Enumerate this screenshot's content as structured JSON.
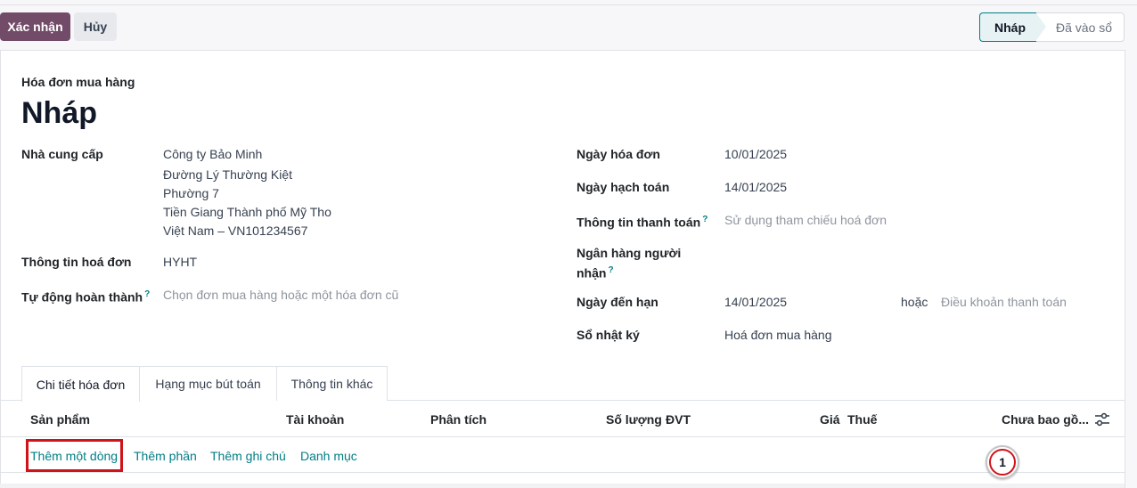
{
  "toolbar": {
    "confirm_label": "Xác nhận",
    "cancel_label": "Hủy"
  },
  "statusbar": {
    "active": "Nháp",
    "next": "Đã vào sổ"
  },
  "header": {
    "doc_type": "Hóa đơn mua hàng",
    "title": "Nháp"
  },
  "left_fields": {
    "vendor_label": "Nhà cung cấp",
    "vendor_lines": [
      "Công ty Bảo Minh",
      "Đường Lý Thường Kiệt",
      "Phường 7",
      "Tiền Giang Thành phố Mỹ Tho",
      "Việt Nam – VN101234567"
    ],
    "bill_ref_label": "Thông tin hoá đơn",
    "bill_ref_value": "HYHT",
    "autocomplete_label": "Tự động hoàn thành",
    "autocomplete_help": "?",
    "autocomplete_placeholder": "Chọn đơn mua hàng hoặc một hóa đơn cũ"
  },
  "right_fields": {
    "invoice_date_label": "Ngày hóa đơn",
    "invoice_date_value": "10/01/2025",
    "accounting_date_label": "Ngày hạch toán",
    "accounting_date_value": "14/01/2025",
    "payment_ref_label": "Thông tin thanh toán",
    "payment_ref_help": "?",
    "payment_ref_placeholder": "Sử dụng tham chiếu hoá đơn",
    "bank_label_line1": "Ngân hàng người",
    "bank_label_line2": "nhận",
    "bank_help": "?",
    "due_date_label": "Ngày đến hạn",
    "due_date_value": "14/01/2025",
    "or_text": "hoặc",
    "payment_terms_placeholder": "Điều khoản thanh toán",
    "journal_label": "Sổ nhật ký",
    "journal_value": "Hoá đơn mua hàng"
  },
  "tabs": [
    {
      "label": "Chi tiết hóa đơn"
    },
    {
      "label": "Hạng mục bút toán"
    },
    {
      "label": "Thông tin khác"
    }
  ],
  "table": {
    "columns": [
      "Sản phẩm",
      "Tài khoản",
      "Phân tích",
      "Số lượng",
      "ĐVT",
      "Giá",
      "Thuế",
      "Chưa bao gồ..."
    ],
    "actions": {
      "add_line": "Thêm một dòng",
      "add_section": "Thêm phần",
      "add_note": "Thêm ghi chú",
      "catalog": "Danh mục"
    }
  },
  "callout": {
    "number": "1"
  },
  "colors": {
    "primary": "#714b67",
    "link": "#017e84",
    "highlight": "#d0121b"
  }
}
